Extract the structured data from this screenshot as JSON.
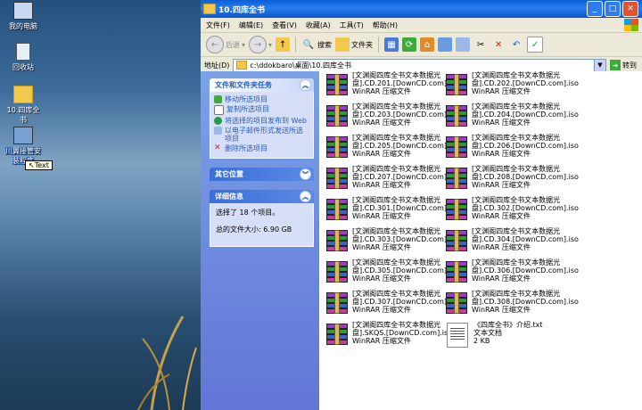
{
  "desktop": {
    "icons": [
      {
        "label": "我的电脑"
      },
      {
        "label": "回收站"
      },
      {
        "label": "10.四库全书"
      },
      {
        "label": "川翼接管安装程序"
      }
    ],
    "tooltip": "↖Text"
  },
  "window": {
    "title": "10.四库全书",
    "menu": [
      "文件(F)",
      "编辑(E)",
      "查看(V)",
      "收藏(A)",
      "工具(T)",
      "帮助(H)"
    ],
    "toolbar": {
      "back": "后退",
      "search": "搜索",
      "folders": "文件夹"
    },
    "address": {
      "label": "地址(D)",
      "path": "c:\\ddokbaro\\桌面\\10.四库全书",
      "go": "转到"
    },
    "tasks": {
      "file_folder_title": "文件和文件夹任务",
      "items": [
        "移动所选项目",
        "复制所选项目",
        "将选择的项目发布到 Web",
        "以电子邮件形式发送所选项目",
        "删除所选项目"
      ],
      "other_places_title": "其它位置",
      "details_title": "详细信息",
      "details_selected": "选择了 18 个项目。",
      "details_size": "总的文件大小: 6.90 GB"
    },
    "files": [
      {
        "name1": "[文渊阁四库全书文本数据光",
        "name2": "盘].CD.201.[DownCD.com].iso",
        "type": "WinRAR 压缩文件"
      },
      {
        "name1": "[文渊阁四库全书文本数据光",
        "name2": "盘].CD.202.[DownCD.com].iso",
        "type": "WinRAR 压缩文件"
      },
      {
        "name1": "[文渊阁四库全书文本数据光",
        "name2": "盘].CD.203.[DownCD.com].iso",
        "type": "WinRAR 压缩文件"
      },
      {
        "name1": "[文渊阁四库全书文本数据光",
        "name2": "盘].CD.204.[DownCD.com].iso",
        "type": "WinRAR 压缩文件"
      },
      {
        "name1": "[文渊阁四库全书文本数据光",
        "name2": "盘].CD.205.[DownCD.com].iso",
        "type": "WinRAR 压缩文件"
      },
      {
        "name1": "[文渊阁四库全书文本数据光",
        "name2": "盘].CD.206.[DownCD.com].iso",
        "type": "WinRAR 压缩文件"
      },
      {
        "name1": "[文渊阁四库全书文本数据光",
        "name2": "盘].CD.207.[DownCD.com].iso",
        "type": "WinRAR 压缩文件"
      },
      {
        "name1": "[文渊阁四库全书文本数据光",
        "name2": "盘].CD.208.[DownCD.com].iso",
        "type": "WinRAR 压缩文件"
      },
      {
        "name1": "[文渊阁四库全书文本数据光",
        "name2": "盘].CD.301.[DownCD.com].iso",
        "type": "WinRAR 压缩文件"
      },
      {
        "name1": "[文渊阁四库全书文本数据光",
        "name2": "盘].CD.302.[DownCD.com].iso",
        "type": "WinRAR 压缩文件"
      },
      {
        "name1": "[文渊阁四库全书文本数据光",
        "name2": "盘].CD.303.[DownCD.com].iso",
        "type": "WinRAR 压缩文件"
      },
      {
        "name1": "[文渊阁四库全书文本数据光",
        "name2": "盘].CD.304.[DownCD.com].iso",
        "type": "WinRAR 压缩文件"
      },
      {
        "name1": "[文渊阁四库全书文本数据光",
        "name2": "盘].CD.305.[DownCD.com].iso",
        "type": "WinRAR 压缩文件"
      },
      {
        "name1": "[文渊阁四库全书文本数据光",
        "name2": "盘].CD.306.[DownCD.com].iso",
        "type": "WinRAR 压缩文件"
      },
      {
        "name1": "[文渊阁四库全书文本数据光",
        "name2": "盘].CD.307.[DownCD.com].iso",
        "type": "WinRAR 压缩文件"
      },
      {
        "name1": "[文渊阁四库全书文本数据光",
        "name2": "盘].CD.308.[DownCD.com].iso",
        "type": "WinRAR 压缩文件"
      },
      {
        "name1": "[文渊阁四库全书文本数据光",
        "name2": "盘].SKQS.[DownCD.com].iso",
        "type": "WinRAR 压缩文件"
      },
      {
        "name1": "《四库全书》介绍.txt",
        "name2": "文本文档",
        "type": "2 KB"
      }
    ]
  }
}
